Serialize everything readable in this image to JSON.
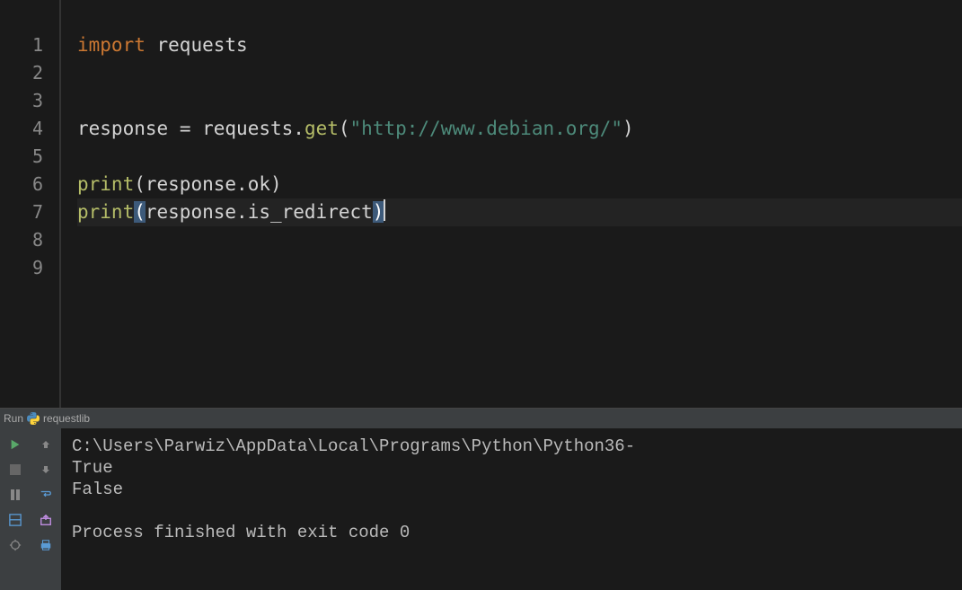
{
  "gutter": {
    "lines": [
      "1",
      "2",
      "3",
      "4",
      "5",
      "6",
      "7",
      "8",
      "9"
    ]
  },
  "code": {
    "line1": {
      "kw": "import",
      "sp": " ",
      "mod": "requests"
    },
    "line4": {
      "var": "response",
      "sp1": " ",
      "op": "=",
      "sp2": " ",
      "mod": "requests",
      "dot": ".",
      "fn": "get",
      "lp": "(",
      "str": "\"http://www.debian.org/\"",
      "rp": ")"
    },
    "line6": {
      "fn": "print",
      "lp": "(",
      "arg": "response",
      "dot": ".",
      "prop": "ok",
      "rp": ")"
    },
    "line7": {
      "fn": "print",
      "lp": "(",
      "arg": "response",
      "dot": ".",
      "prop": "is_redirect",
      "rp": ")"
    }
  },
  "runPanel": {
    "label": "Run",
    "scriptName": "requestlib"
  },
  "console": {
    "line1": "C:\\Users\\Parwiz\\AppData\\Local\\Programs\\Python\\Python36-",
    "line2": "True",
    "line3": "False",
    "line4": "",
    "line5": "Process finished with exit code 0"
  }
}
